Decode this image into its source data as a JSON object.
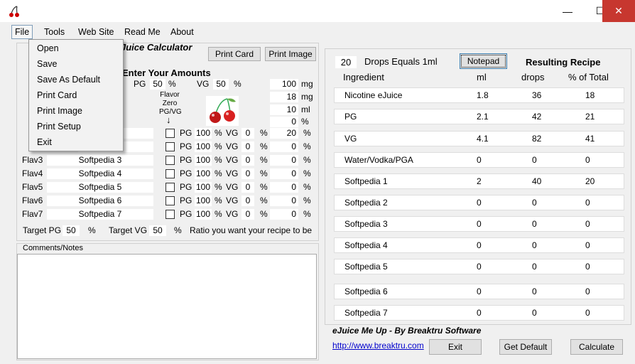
{
  "window": {
    "minimize": "—",
    "maximize": "☐",
    "close": "✕"
  },
  "menu": {
    "file": "File",
    "tools": "Tools",
    "website": "Web Site",
    "readme": "Read Me",
    "about": "About"
  },
  "file_menu": [
    "Open",
    "Save",
    "Save As Default",
    "Print Card",
    "Print Image",
    "Print Setup",
    "Exit"
  ],
  "left": {
    "title": "Juice Calculator",
    "print_card": "Print Card",
    "print_image": "Print Image",
    "enter_amounts": "Enter Your Amounts",
    "pg_label": "PG",
    "pg_val": "50",
    "pct": "%",
    "vg_label": "VG",
    "vg_val": "50",
    "flavor_zero": [
      "Flavor",
      "Zero",
      "PG/VG"
    ],
    "amounts": [
      {
        "val": "100",
        "unit": "mg"
      },
      {
        "val": "18",
        "unit": "mg"
      },
      {
        "val": "10",
        "unit": "ml"
      },
      {
        "val": "0",
        "unit": "%"
      }
    ],
    "flavors": [
      {
        "label": "",
        "name": "",
        "pg": "100",
        "vg": "0",
        "amt": "20"
      },
      {
        "label": "",
        "name": "",
        "pg": "100",
        "vg": "0",
        "amt": "0"
      },
      {
        "label": "Flav3",
        "name": "Softpedia 3",
        "pg": "100",
        "vg": "0",
        "amt": "0"
      },
      {
        "label": "Flav4",
        "name": "Softpedia 4",
        "pg": "100",
        "vg": "0",
        "amt": "0"
      },
      {
        "label": "Flav5",
        "name": "Softpedia  5",
        "pg": "100",
        "vg": "0",
        "amt": "0"
      },
      {
        "label": "Flav6",
        "name": "Softpedia  6",
        "pg": "100",
        "vg": "0",
        "amt": "0"
      },
      {
        "label": "Flav7",
        "name": "Softpedia  7",
        "pg": "100",
        "vg": "0",
        "amt": "0"
      }
    ],
    "target_pg_label": "Target PG",
    "target_pg": "50",
    "target_vg_label": "Target VG",
    "target_vg": "50",
    "ratio_text": "Ratio you want your recipe to be",
    "comments_label": "Comments/Notes",
    "pg_short": "PG",
    "vg_short": "VG"
  },
  "right": {
    "drops": "20",
    "drops_label": "Drops Equals 1ml",
    "notepad": "Notepad",
    "resulting": "Resulting Recipe",
    "headers": {
      "ingredient": "Ingredient",
      "ml": "ml",
      "drops": "drops",
      "pct": "% of Total"
    },
    "rows": [
      {
        "name": "Nicotine eJuice",
        "ml": "1.8",
        "drops": "36",
        "pct": "18"
      },
      {
        "name": "PG",
        "ml": "2.1",
        "drops": "42",
        "pct": "21"
      },
      {
        "name": "VG",
        "ml": "4.1",
        "drops": "82",
        "pct": "41"
      },
      {
        "name": "Water/Vodka/PGA",
        "ml": "0",
        "drops": "0",
        "pct": "0"
      },
      {
        "name": "Softpedia 1",
        "ml": "2",
        "drops": "40",
        "pct": "20"
      },
      {
        "name": "Softpedia 2",
        "ml": "0",
        "drops": "0",
        "pct": "0"
      },
      {
        "name": "Softpedia 3",
        "ml": "0",
        "drops": "0",
        "pct": "0"
      },
      {
        "name": "Softpedia 4",
        "ml": "0",
        "drops": "0",
        "pct": "0"
      },
      {
        "name": "Softpedia  5",
        "ml": "0",
        "drops": "0",
        "pct": "0"
      },
      {
        "name": "Softpedia  6",
        "ml": "0",
        "drops": "0",
        "pct": "0"
      },
      {
        "name": "Softpedia  7",
        "ml": "0",
        "drops": "0",
        "pct": "0"
      }
    ],
    "brand": "eJuice Me Up -  By Breaktru Software",
    "link": "http://www.breaktru.com",
    "exit": "Exit",
    "get_default": "Get Default",
    "calculate": "Calculate"
  }
}
